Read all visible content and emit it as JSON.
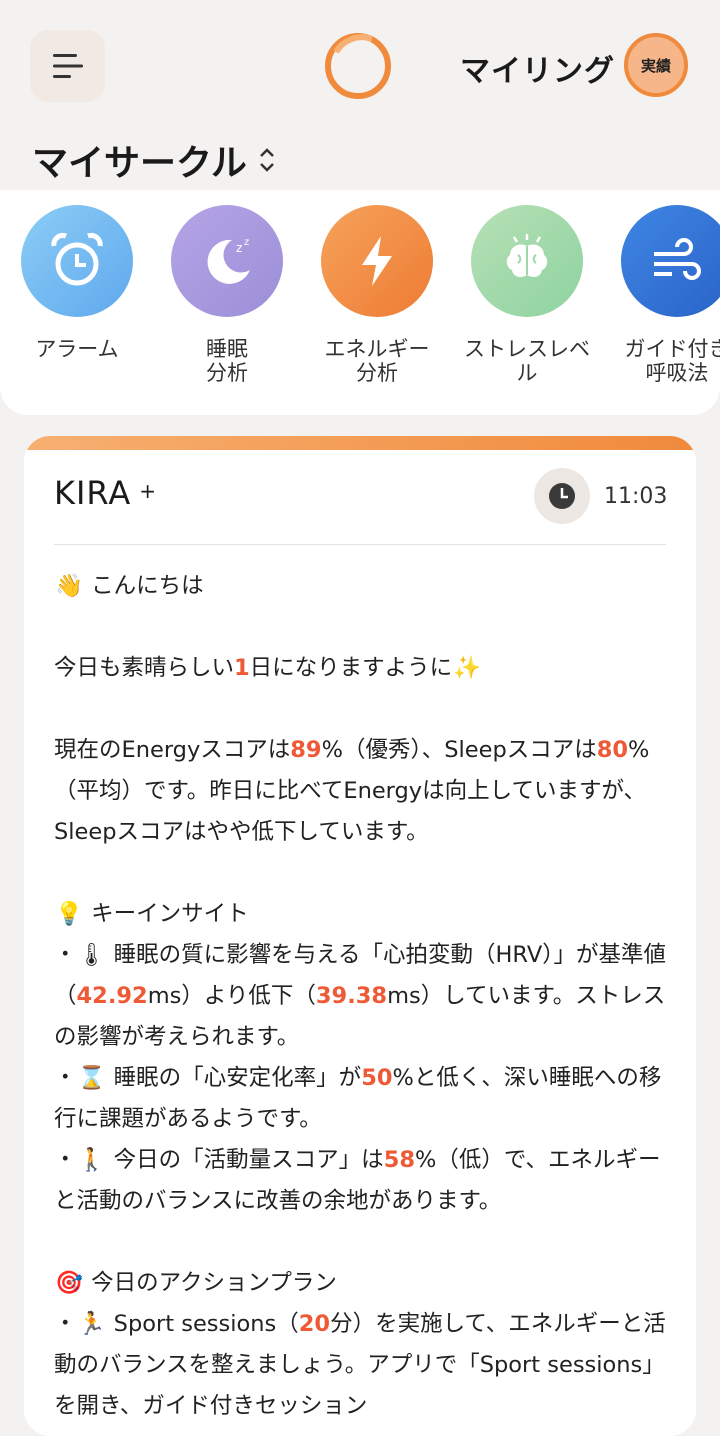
{
  "header": {
    "title": "マイリング",
    "badge": "実績"
  },
  "circles": {
    "title": "マイサークル",
    "items": [
      {
        "label": "アラーム",
        "icon": "alarm-clock-icon",
        "color": "#6fb8f0"
      },
      {
        "label": "睡眠\n分析",
        "icon": "moon-sleep-icon",
        "color": "#a594db"
      },
      {
        "label": "エネルギー\n分析",
        "icon": "lightning-icon",
        "color": "#f08a3c"
      },
      {
        "label": "ストレスレベ\nル",
        "icon": "brain-icon",
        "color": "#9fd8a8"
      },
      {
        "label": "ガイド付き\n呼吸法",
        "icon": "wind-icon",
        "color": "#2e6fd6"
      }
    ]
  },
  "kira": {
    "title": "KIRA",
    "plus": "+",
    "time": "11:03",
    "greeting": "こんにちは",
    "wish_pre": "今日も素晴らしい",
    "wish_num": "1",
    "wish_post": "日になりますように",
    "score_1": "現在のEnergyスコアは",
    "energy_score": "89",
    "score_2": "%（優秀）、Sleepスコアは",
    "sleep_score": "80",
    "score_3": "%（平均）です。昨日に比べてEnergyは向上していますが、Sleepスコアはやや低下しています。",
    "insight_title": "キーインサイト",
    "insight1_1": "睡眠の質に影響を与える「心拍変動（HRV）」が基準値（",
    "hrv_base": "42.92",
    "insight1_2": "ms）より低下（",
    "hrv_now": "39.38",
    "insight1_3": "ms）しています。ストレスの影響が考えられます。",
    "insight2_1": "睡眠の「心安定化率」が",
    "stability": "50",
    "insight2_2": "%と低く、深い睡眠への移行に課題があるようです。",
    "insight3_1": "今日の「活動量スコア」は",
    "activity": "58",
    "insight3_2": "%（低）で、エネルギーと活動のバランスに改善の余地があります。",
    "plan_title": "今日のアクションプラン",
    "plan1_1": "Sport sessions（",
    "sport_minutes": "20",
    "plan1_2": "分）を実施して、エネルギーと活動のバランスを整えましょう。アプリで「Sport sessions」を開き、ガイド付きセッション"
  },
  "colors": {
    "accent": "#f08a3c",
    "highlight": "#ef5a36"
  }
}
